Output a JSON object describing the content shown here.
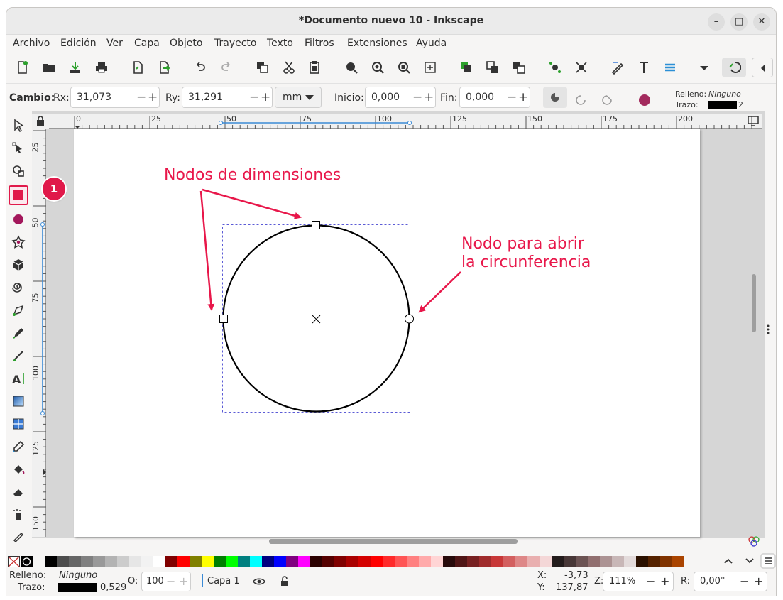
{
  "window": {
    "title": "*Documento nuevo 10 - Inkscape",
    "controls": [
      "–",
      "□",
      "✕"
    ]
  },
  "menu": [
    "Archivo",
    "Edición",
    "Ver",
    "Capa",
    "Objeto",
    "Trayecto",
    "Texto",
    "Filtros",
    "Extensiones",
    "Ayuda"
  ],
  "toolbar": {
    "icons": [
      "new-document-icon",
      "open-icon",
      "import-icon",
      "print-icon",
      "duplicate-icon",
      "export-icon",
      "undo-icon",
      "redo-icon",
      "copy-icon",
      "cut-icon",
      "paste-icon",
      "zoom-selection-icon",
      "zoom-drawing-icon",
      "zoom-page-icon",
      "zoom-center-icon",
      "group-icon",
      "clone-icon",
      "unlink-icon",
      "snap-nodes-icon",
      "snap-objects-icon",
      "xml-editor-icon",
      "text-font-icon",
      "layers-icon",
      "overflow-menu-icon",
      "snap-toggle-icon",
      "collapse-icon"
    ]
  },
  "controls": {
    "cambio_label": "Cambio:",
    "rx_label": "Rx:",
    "rx_value": "31,073",
    "ry_label": "Ry:",
    "ry_value": "31,291",
    "unit": "mm",
    "inicio_label": "Inicio:",
    "inicio_value": "0,000",
    "fin_label": "Fin:",
    "fin_value": "0,000",
    "fill_label": "Relleno:",
    "fill_value": "Ninguno",
    "stroke_label": "Trazo:",
    "stroke_width": "2"
  },
  "tools": [
    "selector-icon",
    "node-icon",
    "tweak-icon",
    "rectangle-icon",
    "circle-icon",
    "star-icon",
    "box3d-icon",
    "spiral-icon",
    "pen-icon",
    "pencil-icon",
    "calligraphy-icon",
    "text-icon",
    "gradient-icon",
    "mesh-icon",
    "dropper-icon",
    "paint-bucket-icon",
    "eraser-icon",
    "spray-icon",
    "measure-icon"
  ],
  "rulers": {
    "h_ticks": [
      "0",
      "25",
      "50",
      "75",
      "100",
      "125",
      "150",
      "175",
      "200"
    ],
    "v_ticks": [
      "25",
      "50",
      "75",
      "100",
      "125",
      "150"
    ]
  },
  "annotations": {
    "label1": "Nodos de dimensiones",
    "label2_line1": "Nodo para abrir",
    "label2_line2": "la circunferencia",
    "badge": "1"
  },
  "colors": {
    "accent": "#e8174a",
    "palette": [
      "#000000",
      "#4d4d4d",
      "#666666",
      "#808080",
      "#999999",
      "#b3b3b3",
      "#cccccc",
      "#e6e6e6",
      "#f2f2f2",
      "#ffffff",
      "#800000",
      "#ff0000",
      "#808000",
      "#ffff00",
      "#008000",
      "#00ff00",
      "#008080",
      "#00ffff",
      "#000080",
      "#0000ff",
      "#800080",
      "#ff00ff",
      "#2b0000",
      "#550000",
      "#800000",
      "#aa0000",
      "#d40000",
      "#ff0000",
      "#ff2a2a",
      "#ff5555",
      "#ff8080",
      "#ffaaaa",
      "#ffd5d5",
      "#280b0b",
      "#501616",
      "#782121",
      "#a02c2c",
      "#c83737",
      "#d35f5f",
      "#de8787",
      "#e9afaf",
      "#f4d7d7",
      "#241c1c",
      "#483737",
      "#6c5353",
      "#916f6f",
      "#ac9393",
      "#c8b7b7",
      "#e3dbdb",
      "#2b1100",
      "#552200",
      "#803300",
      "#aa4400"
    ]
  },
  "status": {
    "fill_label": "Relleno:",
    "fill_value": "Ninguno",
    "stroke_label": "Trazo:",
    "stroke_width": "0,529",
    "opacity_label": "O:",
    "opacity_value": "100",
    "layer": "Capa 1",
    "x_label": "X:",
    "x_value": "-3,73",
    "y_label": "Y:",
    "y_value": "137,87",
    "zoom_label": "Z:",
    "zoom_value": "111%",
    "rotation_label": "R:",
    "rotation_value": "0,00°"
  }
}
